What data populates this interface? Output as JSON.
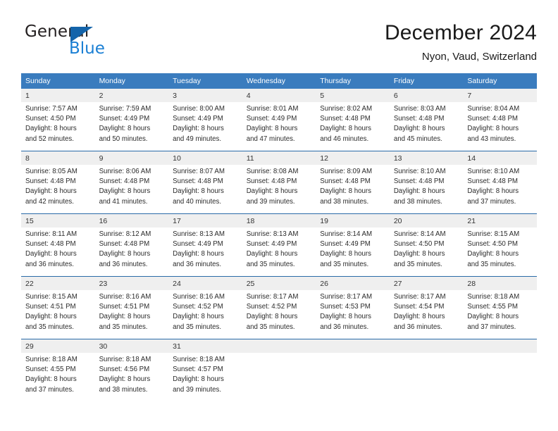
{
  "brand": {
    "name_part1": "General",
    "name_part2": "Blue",
    "flag_icon": "triangle-flag-icon"
  },
  "header": {
    "title": "December 2024",
    "subtitle": "Nyon, Vaud, Switzerland"
  },
  "colors": {
    "header_bar": "#3a7cbe",
    "row_divider": "#2a6ba8",
    "daynum_band": "#efefef",
    "brand_blue": "#1a7fd4",
    "brand_flag": "#1464aa"
  },
  "weekday_headers": [
    "Sunday",
    "Monday",
    "Tuesday",
    "Wednesday",
    "Thursday",
    "Friday",
    "Saturday"
  ],
  "weeks": [
    [
      {
        "day": "1",
        "sunrise": "Sunrise: 7:57 AM",
        "sunset": "Sunset: 4:50 PM",
        "daylight_line1": "Daylight: 8 hours",
        "daylight_line2": "and 52 minutes."
      },
      {
        "day": "2",
        "sunrise": "Sunrise: 7:59 AM",
        "sunset": "Sunset: 4:49 PM",
        "daylight_line1": "Daylight: 8 hours",
        "daylight_line2": "and 50 minutes."
      },
      {
        "day": "3",
        "sunrise": "Sunrise: 8:00 AM",
        "sunset": "Sunset: 4:49 PM",
        "daylight_line1": "Daylight: 8 hours",
        "daylight_line2": "and 49 minutes."
      },
      {
        "day": "4",
        "sunrise": "Sunrise: 8:01 AM",
        "sunset": "Sunset: 4:49 PM",
        "daylight_line1": "Daylight: 8 hours",
        "daylight_line2": "and 47 minutes."
      },
      {
        "day": "5",
        "sunrise": "Sunrise: 8:02 AM",
        "sunset": "Sunset: 4:48 PM",
        "daylight_line1": "Daylight: 8 hours",
        "daylight_line2": "and 46 minutes."
      },
      {
        "day": "6",
        "sunrise": "Sunrise: 8:03 AM",
        "sunset": "Sunset: 4:48 PM",
        "daylight_line1": "Daylight: 8 hours",
        "daylight_line2": "and 45 minutes."
      },
      {
        "day": "7",
        "sunrise": "Sunrise: 8:04 AM",
        "sunset": "Sunset: 4:48 PM",
        "daylight_line1": "Daylight: 8 hours",
        "daylight_line2": "and 43 minutes."
      }
    ],
    [
      {
        "day": "8",
        "sunrise": "Sunrise: 8:05 AM",
        "sunset": "Sunset: 4:48 PM",
        "daylight_line1": "Daylight: 8 hours",
        "daylight_line2": "and 42 minutes."
      },
      {
        "day": "9",
        "sunrise": "Sunrise: 8:06 AM",
        "sunset": "Sunset: 4:48 PM",
        "daylight_line1": "Daylight: 8 hours",
        "daylight_line2": "and 41 minutes."
      },
      {
        "day": "10",
        "sunrise": "Sunrise: 8:07 AM",
        "sunset": "Sunset: 4:48 PM",
        "daylight_line1": "Daylight: 8 hours",
        "daylight_line2": "and 40 minutes."
      },
      {
        "day": "11",
        "sunrise": "Sunrise: 8:08 AM",
        "sunset": "Sunset: 4:48 PM",
        "daylight_line1": "Daylight: 8 hours",
        "daylight_line2": "and 39 minutes."
      },
      {
        "day": "12",
        "sunrise": "Sunrise: 8:09 AM",
        "sunset": "Sunset: 4:48 PM",
        "daylight_line1": "Daylight: 8 hours",
        "daylight_line2": "and 38 minutes."
      },
      {
        "day": "13",
        "sunrise": "Sunrise: 8:10 AM",
        "sunset": "Sunset: 4:48 PM",
        "daylight_line1": "Daylight: 8 hours",
        "daylight_line2": "and 38 minutes."
      },
      {
        "day": "14",
        "sunrise": "Sunrise: 8:10 AM",
        "sunset": "Sunset: 4:48 PM",
        "daylight_line1": "Daylight: 8 hours",
        "daylight_line2": "and 37 minutes."
      }
    ],
    [
      {
        "day": "15",
        "sunrise": "Sunrise: 8:11 AM",
        "sunset": "Sunset: 4:48 PM",
        "daylight_line1": "Daylight: 8 hours",
        "daylight_line2": "and 36 minutes."
      },
      {
        "day": "16",
        "sunrise": "Sunrise: 8:12 AM",
        "sunset": "Sunset: 4:48 PM",
        "daylight_line1": "Daylight: 8 hours",
        "daylight_line2": "and 36 minutes."
      },
      {
        "day": "17",
        "sunrise": "Sunrise: 8:13 AM",
        "sunset": "Sunset: 4:49 PM",
        "daylight_line1": "Daylight: 8 hours",
        "daylight_line2": "and 36 minutes."
      },
      {
        "day": "18",
        "sunrise": "Sunrise: 8:13 AM",
        "sunset": "Sunset: 4:49 PM",
        "daylight_line1": "Daylight: 8 hours",
        "daylight_line2": "and 35 minutes."
      },
      {
        "day": "19",
        "sunrise": "Sunrise: 8:14 AM",
        "sunset": "Sunset: 4:49 PM",
        "daylight_line1": "Daylight: 8 hours",
        "daylight_line2": "and 35 minutes."
      },
      {
        "day": "20",
        "sunrise": "Sunrise: 8:14 AM",
        "sunset": "Sunset: 4:50 PM",
        "daylight_line1": "Daylight: 8 hours",
        "daylight_line2": "and 35 minutes."
      },
      {
        "day": "21",
        "sunrise": "Sunrise: 8:15 AM",
        "sunset": "Sunset: 4:50 PM",
        "daylight_line1": "Daylight: 8 hours",
        "daylight_line2": "and 35 minutes."
      }
    ],
    [
      {
        "day": "22",
        "sunrise": "Sunrise: 8:15 AM",
        "sunset": "Sunset: 4:51 PM",
        "daylight_line1": "Daylight: 8 hours",
        "daylight_line2": "and 35 minutes."
      },
      {
        "day": "23",
        "sunrise": "Sunrise: 8:16 AM",
        "sunset": "Sunset: 4:51 PM",
        "daylight_line1": "Daylight: 8 hours",
        "daylight_line2": "and 35 minutes."
      },
      {
        "day": "24",
        "sunrise": "Sunrise: 8:16 AM",
        "sunset": "Sunset: 4:52 PM",
        "daylight_line1": "Daylight: 8 hours",
        "daylight_line2": "and 35 minutes."
      },
      {
        "day": "25",
        "sunrise": "Sunrise: 8:17 AM",
        "sunset": "Sunset: 4:52 PM",
        "daylight_line1": "Daylight: 8 hours",
        "daylight_line2": "and 35 minutes."
      },
      {
        "day": "26",
        "sunrise": "Sunrise: 8:17 AM",
        "sunset": "Sunset: 4:53 PM",
        "daylight_line1": "Daylight: 8 hours",
        "daylight_line2": "and 36 minutes."
      },
      {
        "day": "27",
        "sunrise": "Sunrise: 8:17 AM",
        "sunset": "Sunset: 4:54 PM",
        "daylight_line1": "Daylight: 8 hours",
        "daylight_line2": "and 36 minutes."
      },
      {
        "day": "28",
        "sunrise": "Sunrise: 8:18 AM",
        "sunset": "Sunset: 4:55 PM",
        "daylight_line1": "Daylight: 8 hours",
        "daylight_line2": "and 37 minutes."
      }
    ],
    [
      {
        "day": "29",
        "sunrise": "Sunrise: 8:18 AM",
        "sunset": "Sunset: 4:55 PM",
        "daylight_line1": "Daylight: 8 hours",
        "daylight_line2": "and 37 minutes."
      },
      {
        "day": "30",
        "sunrise": "Sunrise: 8:18 AM",
        "sunset": "Sunset: 4:56 PM",
        "daylight_line1": "Daylight: 8 hours",
        "daylight_line2": "and 38 minutes."
      },
      {
        "day": "31",
        "sunrise": "Sunrise: 8:18 AM",
        "sunset": "Sunset: 4:57 PM",
        "daylight_line1": "Daylight: 8 hours",
        "daylight_line2": "and 39 minutes."
      },
      {
        "day": "",
        "sunrise": "",
        "sunset": "",
        "daylight_line1": "",
        "daylight_line2": ""
      },
      {
        "day": "",
        "sunrise": "",
        "sunset": "",
        "daylight_line1": "",
        "daylight_line2": ""
      },
      {
        "day": "",
        "sunrise": "",
        "sunset": "",
        "daylight_line1": "",
        "daylight_line2": ""
      },
      {
        "day": "",
        "sunrise": "",
        "sunset": "",
        "daylight_line1": "",
        "daylight_line2": ""
      }
    ]
  ]
}
